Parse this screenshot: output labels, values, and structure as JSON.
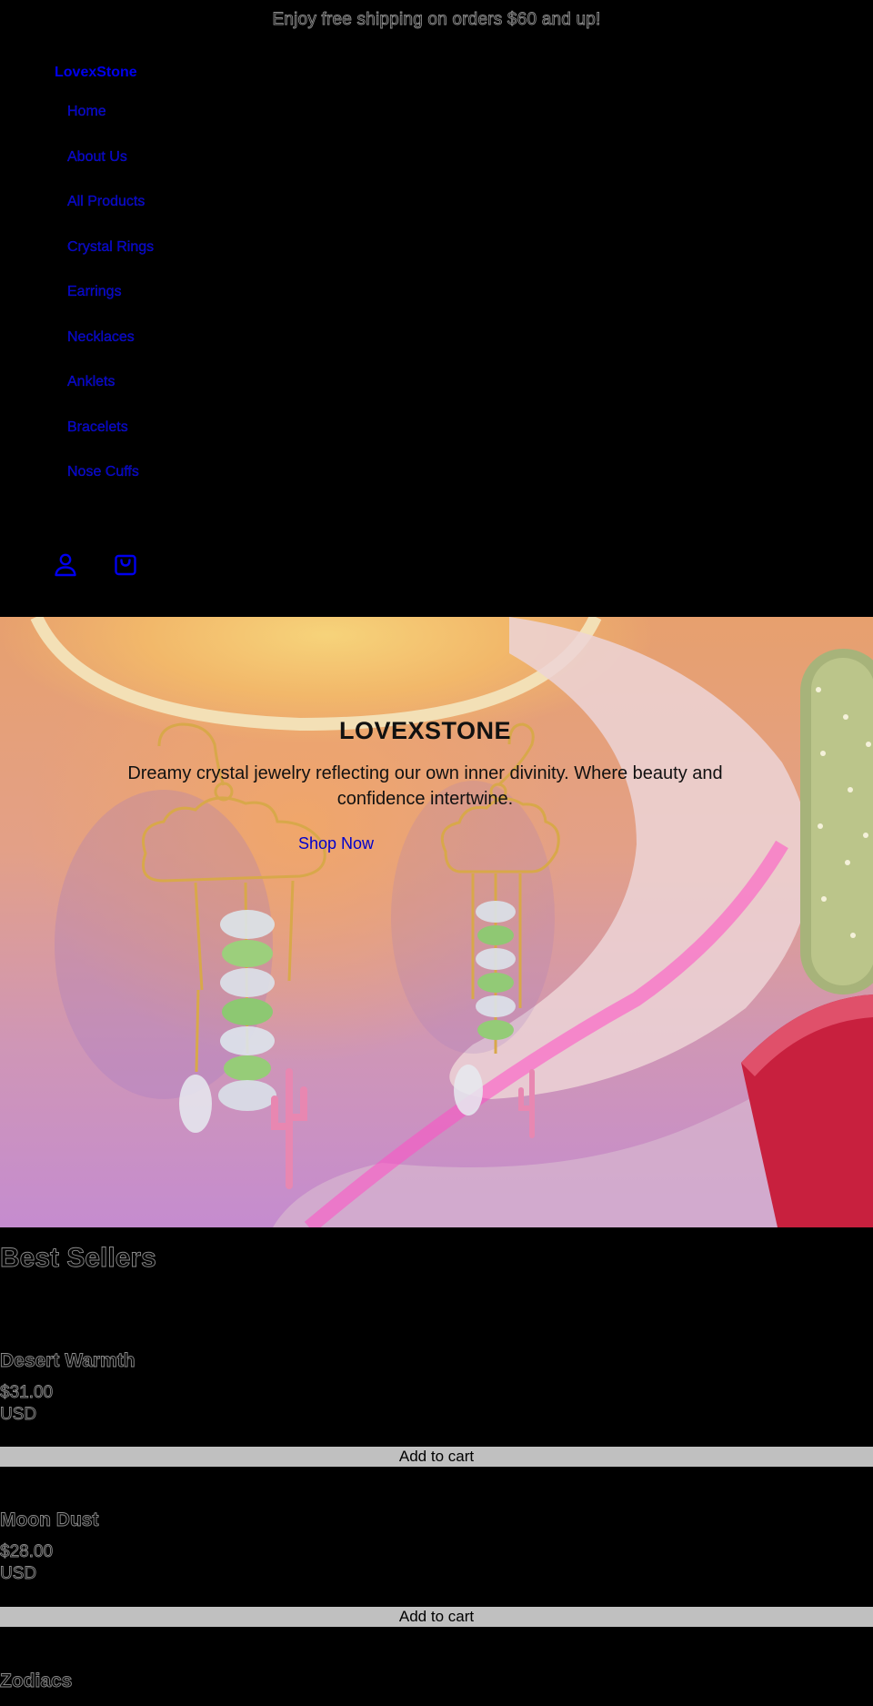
{
  "announcement": "Enjoy free shipping on orders $60 and up!",
  "header": {
    "logo": "LovexStone",
    "nav": [
      "Home",
      "About Us",
      "All Products",
      "Crystal Rings",
      "Earrings",
      "Necklaces",
      "Anklets",
      "Bracelets",
      "Nose Cuffs"
    ],
    "icons": [
      "account-icon",
      "cart-icon"
    ],
    "link_color": "#0000ee"
  },
  "hero": {
    "title": "LOVEXSTONE",
    "text": "Dreamy crystal jewelry reflecting our own inner divinity. Where beauty and confidence intertwine.",
    "cta": "Shop Now"
  },
  "best_sellers": {
    "title": "Best Sellers",
    "products": [
      {
        "name": "Desert Warmth",
        "price": "$31.00",
        "currency": "USD",
        "button": "Add to cart"
      },
      {
        "name": "Moon Dust",
        "price": "$28.00",
        "currency": "USD",
        "button": "Add to cart"
      },
      {
        "name": "Zodiacs"
      }
    ]
  }
}
